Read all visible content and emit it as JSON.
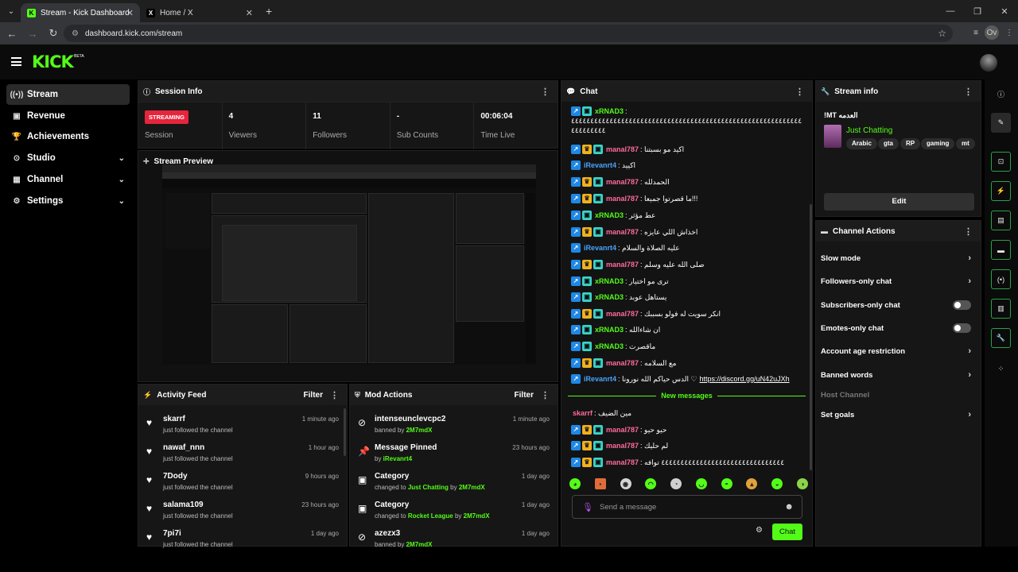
{
  "browser": {
    "tabs": [
      {
        "title": "Stream - Kick Dashboard",
        "favicon": "kick-icon"
      },
      {
        "title": "Home / X",
        "favicon": "x-icon"
      }
    ],
    "url": "dashboard.kick.com/stream",
    "profile": "Ov"
  },
  "header": {
    "logo": "KICK",
    "beta": "BETA"
  },
  "sidebar": {
    "items": [
      {
        "label": "Stream",
        "icon": "broadcast-icon"
      },
      {
        "label": "Revenue",
        "icon": "revenue-icon"
      },
      {
        "label": "Achievements",
        "icon": "trophy-icon"
      },
      {
        "label": "Studio",
        "icon": "studio-icon"
      },
      {
        "label": "Channel",
        "icon": "channel-icon"
      },
      {
        "label": "Settings",
        "icon": "gear-icon"
      }
    ]
  },
  "session": {
    "title": "Session Info",
    "status": "STREAMING",
    "status_label": "Session",
    "stats": [
      {
        "value": "4",
        "label": "Viewers"
      },
      {
        "value": "11",
        "label": "Followers"
      },
      {
        "value": "-",
        "label": "Sub Counts"
      },
      {
        "value": "00:06:04",
        "label": "Time Live"
      }
    ]
  },
  "preview": {
    "title": "Stream Preview"
  },
  "activity": {
    "title": "Activity Feed",
    "filter": "Filter",
    "items": [
      {
        "name": "skarrf",
        "sub": "just followed the channel",
        "time": "1 minute ago"
      },
      {
        "name": "nawaf_nnn",
        "sub": "just followed the channel",
        "time": "1 hour ago"
      },
      {
        "name": "7Dody",
        "sub": "just followed the channel",
        "time": "9 hours ago"
      },
      {
        "name": "salama109",
        "sub": "just followed the channel",
        "time": "23 hours ago"
      },
      {
        "name": "7pi7i",
        "sub": "just followed the channel",
        "time": "1 day ago"
      }
    ]
  },
  "mod": {
    "title": "Mod Actions",
    "filter": "Filter",
    "items": [
      {
        "name": "intenseunclevcpc2",
        "pre": "banned by ",
        "hl": "2M7mdX",
        "mid": "",
        "hl2": "",
        "time": "1 minute ago",
        "icon": "ban-icon"
      },
      {
        "name": "Message Pinned",
        "pre": "by ",
        "hl": "iRevanrt4",
        "mid": "",
        "hl2": "",
        "time": "23 hours ago",
        "icon": "pin-icon"
      },
      {
        "name": "Category",
        "pre": "changed to ",
        "hl": "Just Chatting",
        "mid": " by ",
        "hl2": "2M7mdX",
        "time": "1 day ago",
        "icon": "category-icon"
      },
      {
        "name": "Category",
        "pre": "changed to ",
        "hl": "Rocket League",
        "mid": " by ",
        "hl2": "2M7mdX",
        "time": "1 day ago",
        "icon": "category-icon"
      },
      {
        "name": "azezx3",
        "pre": "banned by ",
        "hl": "2M7mdX",
        "mid": "",
        "hl2": "",
        "time": "1 day ago",
        "icon": "ban-icon"
      }
    ]
  },
  "chat": {
    "title": "Chat",
    "messages": [
      {
        "user": "xRNAD3",
        "color": "#53fc18",
        "text": "٤٤٤٤٤٤٤٤٤٤٤٤٤٤٤٤٤٤٤٤٤٤٤٤٤٤٤٤٤٤٤٤٤٤٤٤٤٤٤٤٤٤٤٤٤٤٤٤٤٤٤٤٤٤٤٤٤٤٤٤٤٤٤٤٤٤٤٤٤",
        "badges": [
          "v",
          "s"
        ]
      },
      {
        "user": "manal787",
        "color": "#ff6b9a",
        "text": "اكيد مو بسبتنا",
        "badges": [
          "v",
          "c",
          "s"
        ]
      },
      {
        "user": "iRevanrt4",
        "color": "#4aa3ff",
        "text": "اكييد",
        "badges": [
          "v"
        ]
      },
      {
        "user": "manal787",
        "color": "#ff6b9a",
        "text": "الحمدلله",
        "badges": [
          "v",
          "c",
          "s"
        ]
      },
      {
        "user": "manal787",
        "color": "#ff6b9a",
        "text": "ما قصرتوا جميعا!!!",
        "badges": [
          "v",
          "c",
          "s"
        ]
      },
      {
        "user": "xRNAD3",
        "color": "#53fc18",
        "text": "عط مؤثر",
        "badges": [
          "v",
          "s"
        ]
      },
      {
        "user": "manal787",
        "color": "#ff6b9a",
        "text": "اخذاش اللي عايزه",
        "badges": [
          "v",
          "c",
          "s"
        ]
      },
      {
        "user": "iRevanrt4",
        "color": "#4aa3ff",
        "text": "عليه الصلاة والسلام",
        "badges": [
          "v"
        ]
      },
      {
        "user": "manal787",
        "color": "#ff6b9a",
        "text": "صلى الله عليه وسلم",
        "badges": [
          "v",
          "c",
          "s"
        ]
      },
      {
        "user": "xRNAD3",
        "color": "#53fc18",
        "text": "ترى مو اختيار",
        "badges": [
          "v",
          "s"
        ]
      },
      {
        "user": "xRNAD3",
        "color": "#53fc18",
        "text": "يستاهل عوبد",
        "badges": [
          "v",
          "s"
        ]
      },
      {
        "user": "manal787",
        "color": "#ff6b9a",
        "text": "انكر سويت له فولو بسببك",
        "badges": [
          "v",
          "c",
          "s"
        ]
      },
      {
        "user": "xRNAD3",
        "color": "#53fc18",
        "text": "ان شاءالله",
        "badges": [
          "v",
          "s"
        ]
      },
      {
        "user": "xRNAD3",
        "color": "#53fc18",
        "text": "ماقصرت",
        "badges": [
          "v",
          "s"
        ]
      },
      {
        "user": "manal787",
        "color": "#ff6b9a",
        "text": "مع السلامه",
        "badges": [
          "v",
          "c",
          "s"
        ]
      },
      {
        "user": "iRevanrt4",
        "color": "#4aa3ff",
        "text": "الدس حياكم الله نورونا ♡ ",
        "link": "https://discord.gg/uN42uJXh",
        "badges": [
          "v"
        ]
      }
    ],
    "new_label": "New messages",
    "new_messages": [
      {
        "user": "skarrf",
        "color": "#ff6b9a",
        "text": "مين الضيف",
        "badges": []
      },
      {
        "user": "manal787",
        "color": "#ff6b9a",
        "text": "حيو حيو",
        "badges": [
          "v",
          "c",
          "s"
        ]
      },
      {
        "user": "manal787",
        "color": "#ff6b9a",
        "text": "لم حليك",
        "badges": [
          "v",
          "c",
          "s"
        ]
      },
      {
        "user": "manal787",
        "color": "#ff6b9a",
        "text": "٤٤٤٤٤٤٤٤٤٤٤٤٤٤٤٤٤٤٤٤٤٤٤٤٤٤٤٤٤٤٤٤ توافه",
        "badges": [
          "v",
          "c",
          "s"
        ]
      }
    ],
    "placeholder": "Send a message",
    "send": "Chat"
  },
  "stream_info": {
    "title": "Stream info",
    "stream_title": "!MT العدمه",
    "category": "Just Chatting",
    "tags": [
      "Arabic",
      "gta",
      "RP",
      "gaming",
      "mt"
    ],
    "edit": "Edit"
  },
  "channel_actions": {
    "title": "Channel Actions",
    "items": [
      {
        "label": "Slow mode",
        "kind": "chev"
      },
      {
        "label": "Followers-only chat",
        "kind": "chev"
      },
      {
        "label": "Subscribers-only chat",
        "kind": "toggle"
      },
      {
        "label": "Emotes-only chat",
        "kind": "toggle"
      },
      {
        "label": "Account age restriction",
        "kind": "chev"
      },
      {
        "label": "Banned words",
        "kind": "chev"
      },
      {
        "label": "Host Channel",
        "kind": "disabled"
      },
      {
        "label": "Set goals",
        "kind": "chev"
      }
    ]
  },
  "colors": {
    "accent": "#53fc18",
    "live": "#e5253c"
  }
}
